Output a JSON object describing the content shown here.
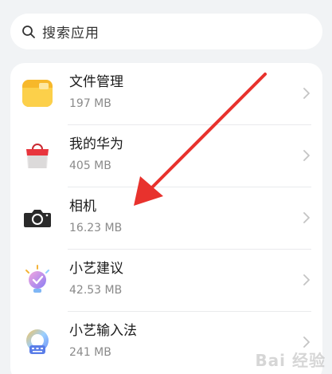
{
  "search": {
    "placeholder": "搜索应用",
    "icon": "search-icon"
  },
  "apps": [
    {
      "name": "文件管理",
      "size": "197 MB",
      "icon": "folder-icon"
    },
    {
      "name": "我的华为",
      "size": "405 MB",
      "icon": "huawei-bag-icon"
    },
    {
      "name": "相机",
      "size": "16.23 MB",
      "icon": "camera-icon"
    },
    {
      "name": "小艺建议",
      "size": "42.53 MB",
      "icon": "bulb-check-icon"
    },
    {
      "name": "小艺输入法",
      "size": "241 MB",
      "icon": "keyboard-icon"
    }
  ],
  "watermark": "Bai 经验",
  "colors": {
    "annotation_arrow": "#e8322d",
    "background": "#f1f3f5"
  }
}
